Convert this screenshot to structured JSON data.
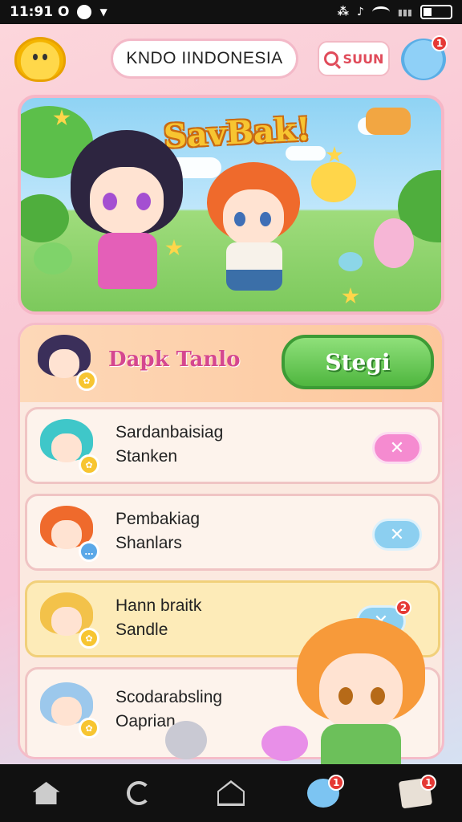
{
  "status_bar": {
    "time": "11:91 O",
    "battery_level": 0.3
  },
  "header": {
    "title": "KNDO IINDONESIA",
    "search_label": "SUUN",
    "notification_count": "1"
  },
  "banner": {
    "title": "SavBak!"
  },
  "hero": {
    "name": "Dapk Tanlo",
    "button_label": "Stegi"
  },
  "items": [
    {
      "line1": "Sardanbaisiag",
      "line2": "Stanken",
      "action_glyph": "✕",
      "color": "#f58bd0"
    },
    {
      "line1": "Pembakiag",
      "line2": "Shanlars",
      "action_glyph": "✕",
      "color": "#8ccff0"
    },
    {
      "line1": "Hann braitk",
      "line2": "Sandle",
      "action_glyph": "✕",
      "color": "#8ccff0",
      "badge": "2"
    },
    {
      "line1": "Scodarabsling",
      "line2": "Oaprian"
    }
  ],
  "bottom_nav": {
    "items": [
      "home-icon",
      "refresh-icon",
      "upload-icon",
      "character-icon",
      "letter-icon"
    ],
    "badges": {
      "character": "1",
      "letter": "1"
    }
  },
  "colors": {
    "accent_green": "#4fb63f",
    "accent_pink": "#d5478f",
    "badge_red": "#e53935"
  }
}
